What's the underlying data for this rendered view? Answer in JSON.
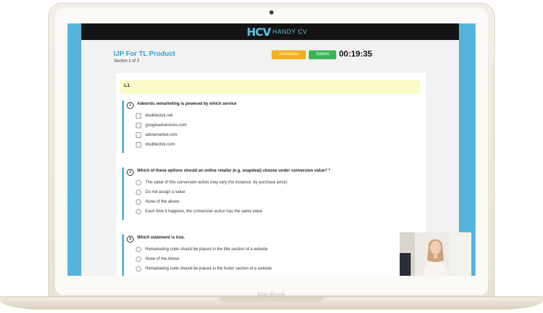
{
  "device": {
    "brand_label": "MacBook"
  },
  "header": {
    "logo_mark": "HCV",
    "logo_text": "HANDY CV"
  },
  "test": {
    "title": "IJP For TL Product",
    "section_progress": "Section 1 of 3",
    "instruction_label": "Instruction",
    "submit_label": "Submit",
    "timer": "00:19:35",
    "section_name": "L1"
  },
  "questions": [
    {
      "number": "1",
      "text": "Adwords remarketing is powered by which service",
      "options": [
        "doubleclick.net",
        "googleadservices.com",
        "adsremarket.com",
        "doubleclick.com"
      ]
    },
    {
      "number": "2",
      "text": "Which of these options should an online retailer (e.g. snapdeal) choose under conversion value? *",
      "options": [
        "The value of this conversion action may vary (for instance, by purchase price)",
        "Do not assign a value",
        "None of the above",
        "Each time it happens, the conversion action has the same value"
      ]
    },
    {
      "number": "3",
      "text": "Which statement is true.",
      "options": [
        "Remarketing code should be placed in the title section of a website",
        "None of the Above",
        "Remarketing code should be placed in the footer section of a website"
      ]
    }
  ],
  "colors": {
    "accent": "#55b3d8",
    "instruction": "#f3b21b",
    "submit": "#3cb55a",
    "section_bar": "#fbfbc8"
  }
}
